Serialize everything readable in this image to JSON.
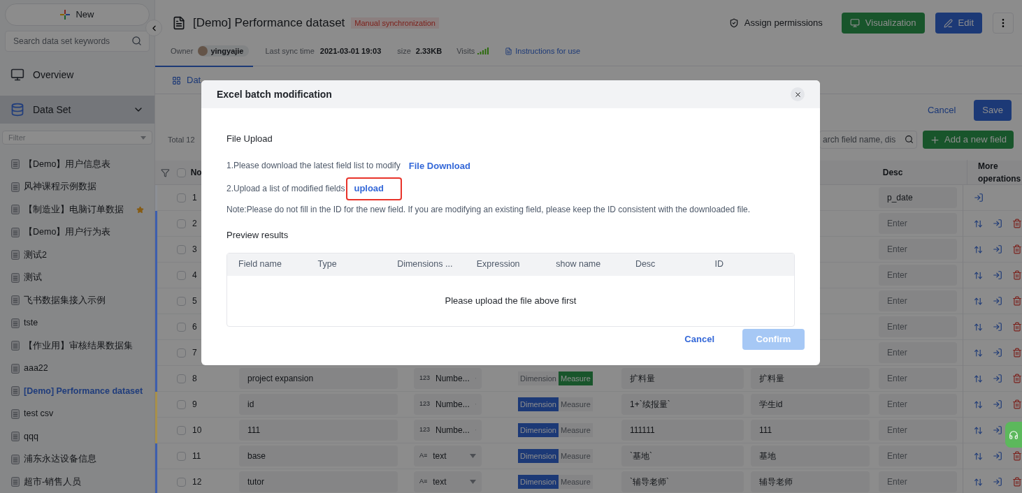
{
  "sidebar": {
    "new_button": "New",
    "search": {
      "placeholder": "Search data set keywords"
    },
    "nav": [
      {
        "label": "Overview",
        "kind": "monitor",
        "selected": false
      },
      {
        "label": "Data Set",
        "kind": "dataset",
        "selected": true,
        "expanded": true
      }
    ],
    "filter": {
      "placeholder": "Filter"
    },
    "datasets": [
      {
        "label": "【Demo】用户信息表",
        "selected": false,
        "starred": false
      },
      {
        "label": "风神课程示例数据",
        "selected": false,
        "starred": false
      },
      {
        "label": "【制造业】电脑订单数据",
        "selected": false,
        "starred": true
      },
      {
        "label": "【Demo】用户行为表",
        "selected": false,
        "starred": false
      },
      {
        "label": "测试2",
        "selected": false,
        "starred": false
      },
      {
        "label": "测试",
        "selected": false,
        "starred": false
      },
      {
        "label": "飞书数据集接入示例",
        "selected": false,
        "starred": false
      },
      {
        "label": "tste",
        "selected": false,
        "starred": false
      },
      {
        "label": "【作业用】审核结果数据集",
        "selected": false,
        "starred": false
      },
      {
        "label": "aaa22",
        "selected": false,
        "starred": false
      },
      {
        "label": "[Demo] Performance dataset",
        "selected": true,
        "starred": false
      },
      {
        "label": "test csv",
        "selected": false,
        "starred": false
      },
      {
        "label": "qqq",
        "selected": false,
        "starred": false
      },
      {
        "label": "浦东永达设备信息",
        "selected": false,
        "starred": false
      },
      {
        "label": "超市-销售人员",
        "selected": false,
        "starred": false
      }
    ]
  },
  "header": {
    "title": "[Demo] Performance dataset",
    "badge": "Manual synchronization",
    "assign": "Assign permissions",
    "visualization": "Visualization",
    "edit": "Edit",
    "meta": {
      "owner_label": "Owner",
      "owner": "yingyajie",
      "sync_label": "Last sync time",
      "sync": "2021-03-01 19:03",
      "size_label": "size",
      "size": "2.33KB",
      "visits_label": "Visits",
      "instructions": "Instructions for use"
    }
  },
  "tabs": [
    {
      "label": "Dat",
      "selected": true
    }
  ],
  "toolbar": {
    "total": "Total 12",
    "cancel": "Cancel",
    "save": "Save",
    "search": {
      "placeholder": "arch field name, dis"
    },
    "add": "Add a new field"
  },
  "table": {
    "all_checked": false,
    "columns": [
      {
        "label": "No"
      },
      {
        "label": "Desc"
      },
      {
        "label": "More operations"
      }
    ],
    "rows": [
      {
        "no": "1",
        "checked": false,
        "color": "#8c8f95",
        "desc": {
          "value": "p_date"
        },
        "actions": [
          {
            "kind": "move"
          }
        ]
      },
      {
        "no": "2",
        "checked": false,
        "color": "#3d5fae",
        "desc": {
          "placeholder": "Enter"
        },
        "actions": [
          {
            "kind": "sort"
          },
          {
            "kind": "move"
          },
          {
            "kind": "delete"
          }
        ]
      },
      {
        "no": "3",
        "checked": false,
        "color": "#3d5fae",
        "desc": {
          "placeholder": "Enter"
        },
        "actions": [
          {
            "kind": "sort"
          },
          {
            "kind": "move"
          },
          {
            "kind": "delete"
          }
        ]
      },
      {
        "no": "4",
        "checked": false,
        "color": "#3d5fae",
        "desc": {
          "placeholder": "Enter"
        },
        "actions": [
          {
            "kind": "sort"
          },
          {
            "kind": "move"
          },
          {
            "kind": "delete"
          }
        ]
      },
      {
        "no": "5",
        "checked": false,
        "color": "#3d5fae",
        "desc": {
          "placeholder": "Enter"
        },
        "actions": [
          {
            "kind": "sort"
          },
          {
            "kind": "move"
          },
          {
            "kind": "delete"
          }
        ]
      },
      {
        "no": "6",
        "checked": false,
        "color": "#3d5fae",
        "desc": {
          "placeholder": "Enter"
        },
        "actions": [
          {
            "kind": "sort"
          },
          {
            "kind": "move"
          },
          {
            "kind": "delete"
          }
        ]
      },
      {
        "no": "7",
        "checked": false,
        "color": "#3d5fae",
        "desc": {
          "placeholder": "Enter"
        },
        "actions": [
          {
            "kind": "sort"
          },
          {
            "kind": "move"
          },
          {
            "kind": "delete"
          }
        ]
      },
      {
        "no": "8",
        "checked": false,
        "color": "#3d5fae",
        "actions": [
          {
            "kind": "sort"
          },
          {
            "kind": "move"
          },
          {
            "kind": "delete"
          }
        ],
        "field_name": "project expansion",
        "type": {
          "icon": "123",
          "label": "Numbe..."
        },
        "roles": [
          {
            "label": "Dimension",
            "selected": false
          },
          {
            "label": "Measure",
            "selected": true
          }
        ],
        "expression": "扩料量",
        "show_name": "扩料量",
        "desc": {
          "placeholder": "Enter"
        }
      },
      {
        "no": "9",
        "checked": false,
        "color": "#a8904a",
        "actions": [
          {
            "kind": "sort"
          },
          {
            "kind": "move"
          },
          {
            "kind": "delete"
          }
        ],
        "field_name": "id",
        "type": {
          "icon": "123",
          "label": "Numbe..."
        },
        "roles": [
          {
            "label": "Dimension",
            "selected": true
          },
          {
            "label": "Measure",
            "selected": false
          }
        ],
        "expression": "1+`续报量`",
        "show_name": "学生id",
        "desc": {
          "placeholder": "Enter"
        }
      },
      {
        "no": "10",
        "checked": false,
        "color": "#a8904a",
        "actions": [
          {
            "kind": "sort"
          },
          {
            "kind": "move"
          }
        ],
        "field_name": "111",
        "type": {
          "icon": "123",
          "label": "Numbe..."
        },
        "roles": [
          {
            "label": "Dimension",
            "selected": true
          },
          {
            "label": "Measure",
            "selected": false
          }
        ],
        "expression": "111111",
        "show_name": "111",
        "desc": {
          "placeholder": "Enter"
        }
      },
      {
        "no": "11",
        "checked": false,
        "color": "#3d5fae",
        "actions": [
          {
            "kind": "sort"
          },
          {
            "kind": "move"
          },
          {
            "kind": "delete"
          }
        ],
        "field_name": "base",
        "type": {
          "icon": "A≡",
          "label": "text"
        },
        "roles": [
          {
            "label": "Dimension",
            "selected": true
          },
          {
            "label": "Measure",
            "selected": false
          }
        ],
        "expression": "`基地`",
        "show_name": "基地",
        "desc": {
          "placeholder": "Enter"
        }
      },
      {
        "no": "12",
        "checked": false,
        "color": "#3d5fae",
        "actions": [
          {
            "kind": "sort"
          },
          {
            "kind": "move"
          },
          {
            "kind": "delete"
          }
        ],
        "field_name": "tutor",
        "type": {
          "icon": "A≡",
          "label": "text"
        },
        "roles": [
          {
            "label": "Dimension",
            "selected": true
          },
          {
            "label": "Measure",
            "selected": false
          }
        ],
        "expression": "`辅导老师`",
        "show_name": "辅导老师",
        "desc": {
          "placeholder": "Enter"
        }
      }
    ]
  },
  "dialog": {
    "title": "Excel batch modification",
    "section": "File Upload",
    "step1": "1.Please download the latest field list to modify",
    "download": "File Download",
    "step2": "2.Upload a list of modified fields",
    "upload": "upload",
    "upload_highlighted": true,
    "note": "Note:Please do not fill in the ID for the new field. If you are modifying an existing field, please keep the ID consistent with the downloaded file.",
    "preview": "Preview results",
    "columns": [
      "Field name",
      "Type",
      "Dimensions ...",
      "Expression",
      "show name",
      "Desc",
      "ID"
    ],
    "empty": "Please upload the file above first",
    "cancel": "Cancel",
    "confirm": "Confirm",
    "confirm_disabled": true
  }
}
